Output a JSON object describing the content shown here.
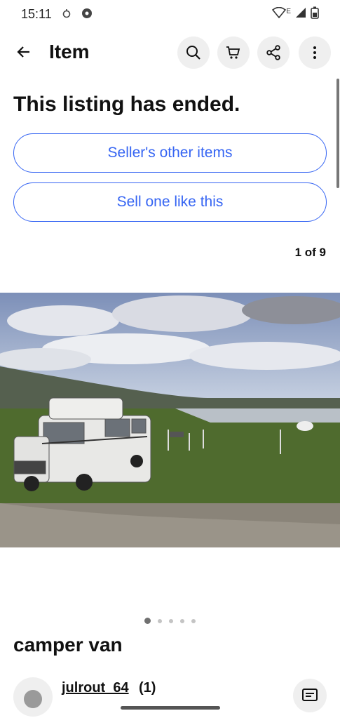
{
  "status_bar": {
    "time": "15:11",
    "network_label": "E"
  },
  "header": {
    "title": "Item"
  },
  "listing": {
    "status_title": "This listing has ended.",
    "sellers_other_items_label": "Seller's other items",
    "sell_one_like_this_label": "Sell one like this",
    "image_counter": "1 of 9",
    "image_total": 9,
    "current_image": 1,
    "visible_dots": 5,
    "title": "camper van"
  },
  "seller": {
    "username": "julrout_64",
    "feedback_count": "(1)"
  },
  "colors": {
    "accent": "#3665f3",
    "icon_bg": "#efefef",
    "text": "#111111"
  },
  "icons": [
    "back-arrow-icon",
    "search-icon",
    "cart-icon",
    "share-icon",
    "more-vert-icon",
    "message-icon"
  ]
}
